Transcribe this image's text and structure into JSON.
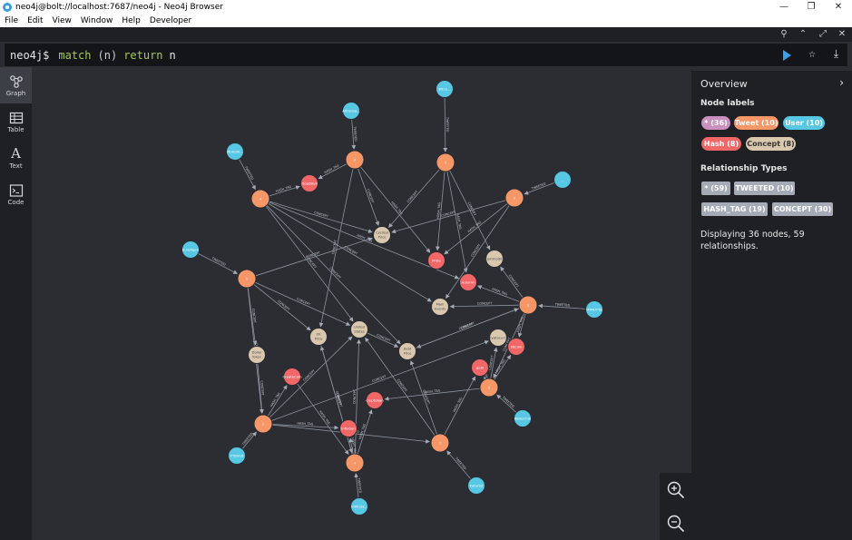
{
  "window": {
    "title": "neo4j@bolt://localhost:7687/neo4j - Neo4j Browser",
    "controls": [
      "—",
      "❐",
      "✕"
    ]
  },
  "menu": [
    "File",
    "Edit",
    "View",
    "Window",
    "Help",
    "Developer"
  ],
  "editor": {
    "prompt": "neo4j$",
    "kw1": "match",
    "var": "n",
    "kw2": "return",
    "ret": "n"
  },
  "sidebar": [
    {
      "label": "Graph",
      "icon": "graph-icon"
    },
    {
      "label": "Table",
      "icon": "table-icon"
    },
    {
      "label": "Text",
      "icon": "text-icon"
    },
    {
      "label": "Code",
      "icon": "code-icon"
    }
  ],
  "overview": {
    "title": "Overview",
    "node_labels_title": "Node labels",
    "node_labels": [
      {
        "text": "* (36)",
        "color": "#c990c0"
      },
      {
        "text": "Tweet (10)",
        "color": "#f79767"
      },
      {
        "text": "User (10)",
        "color": "#57c7e3"
      },
      {
        "text": "Hash (8)",
        "color": "#f16667"
      },
      {
        "text": "Concept (8)",
        "color": "#d9c8ae"
      }
    ],
    "rel_types_title": "Relationship Types",
    "rel_types": [
      "* (59)",
      "TWEETED (10)",
      "HASH_TAG (19)",
      "CONCEPT (30)"
    ],
    "status": "Displaying 36 nodes, 59 relationships."
  },
  "colors": {
    "tweet": "#f79767",
    "user": "#57c7e3",
    "hash": "#f16667",
    "concept": "#d9c8ae",
    "run": "#3aa0e8"
  },
  "graph": {
    "nodes": [
      {
        "id": "t1",
        "type": "tweet",
        "label": "4"
      },
      {
        "id": "t2",
        "type": "tweet",
        "label": "1"
      },
      {
        "id": "t3",
        "type": "tweet",
        "label": "4"
      },
      {
        "id": "t4",
        "type": "tweet",
        "label": "9"
      },
      {
        "id": "t5",
        "type": "tweet",
        "label": "1"
      },
      {
        "id": "t6",
        "type": "tweet",
        "label": "1"
      },
      {
        "id": "t7",
        "type": "tweet",
        "label": "1"
      },
      {
        "id": "t8",
        "type": "tweet",
        "label": "4"
      },
      {
        "id": "t9",
        "type": "tweet",
        "label": "1"
      },
      {
        "id": "t10",
        "type": "tweet",
        "label": "2"
      },
      {
        "id": "u1",
        "type": "user",
        "label": "Bitco..."
      },
      {
        "id": "u2",
        "type": "user",
        "label": "Altruista..."
      },
      {
        "id": "u3",
        "type": "user",
        "label": "Mufe90..."
      },
      {
        "id": "u4",
        "type": "user",
        "label": "..."
      },
      {
        "id": "u5",
        "type": "user",
        "label": "EuroAgen"
      },
      {
        "id": "u6",
        "type": "user",
        "label": "IMMUTTA"
      },
      {
        "id": "u7",
        "type": "user",
        "label": "Kellerchai"
      },
      {
        "id": "u8",
        "type": "user",
        "label": "FTBimit"
      },
      {
        "id": "u9",
        "type": "user",
        "label": "FuturSo"
      },
      {
        "id": "u10",
        "type": "user",
        "label": "Infiltrat..."
      },
      {
        "id": "h1",
        "type": "hash",
        "label": "GoodBull"
      },
      {
        "id": "h2",
        "type": "hash",
        "label": "Pride"
      },
      {
        "id": "h3",
        "type": "hash",
        "label": "Autumn"
      },
      {
        "id": "h4",
        "type": "hash",
        "label": "bitcoin"
      },
      {
        "id": "h5",
        "type": "hash",
        "label": "gold"
      },
      {
        "id": "h6",
        "type": "hash",
        "label": "CryptoCoin"
      },
      {
        "id": "h7",
        "type": "hash",
        "label": "cryptoban"
      },
      {
        "id": "h8",
        "type": "hash",
        "label": "Inflation"
      },
      {
        "id": "c1",
        "type": "concept",
        "label": "Cyclical Price"
      },
      {
        "id": "c2",
        "type": "concept",
        "label": "Commodity"
      },
      {
        "id": "c3",
        "type": "concept",
        "label": "Main Events"
      },
      {
        "id": "c4",
        "type": "concept",
        "label": "United States"
      },
      {
        "id": "c5",
        "type": "concept",
        "label": "Oil Price"
      },
      {
        "id": "c6",
        "type": "concept",
        "label": "Dollar Token"
      },
      {
        "id": "c7",
        "type": "concept",
        "label": "Debt Price"
      },
      {
        "id": "c8",
        "type": "concept",
        "label": "Cryptocurr..."
      }
    ],
    "edges": [
      {
        "s": "u1",
        "t": "t2",
        "label": "TWEETED"
      },
      {
        "s": "u2",
        "t": "t1",
        "label": "TWEETED"
      },
      {
        "s": "u3",
        "t": "t3",
        "label": "TWEETED"
      },
      {
        "s": "u4",
        "t": "t4",
        "label": "TWEETED"
      },
      {
        "s": "u5",
        "t": "t5",
        "label": "TWEETED"
      },
      {
        "s": "u6",
        "t": "t6",
        "label": "TWEETED"
      },
      {
        "s": "u7",
        "t": "t10",
        "label": "TWEETED"
      },
      {
        "s": "u8",
        "t": "t7",
        "label": "TWEETED"
      },
      {
        "s": "u9",
        "t": "t9",
        "label": "TWEETED"
      },
      {
        "s": "u10",
        "t": "t8",
        "label": "TWEETED"
      },
      {
        "s": "t1",
        "t": "h1",
        "label": "HASH_TAG"
      },
      {
        "s": "t1",
        "t": "c1",
        "label": "CONCEPT"
      },
      {
        "s": "t1",
        "t": "h2",
        "label": "HASH_TAG"
      },
      {
        "s": "t1",
        "t": "c5",
        "label": "CONCEPT"
      },
      {
        "s": "t3",
        "t": "h1",
        "label": "HASH_TAG"
      },
      {
        "s": "t3",
        "t": "c1",
        "label": "CONCEPT"
      },
      {
        "s": "t3",
        "t": "c4",
        "label": "CONCEPT"
      },
      {
        "s": "t3",
        "t": "c7",
        "label": "CONCEPT"
      },
      {
        "s": "t3",
        "t": "c3",
        "label": "CONCEPT"
      },
      {
        "s": "t3",
        "t": "h3",
        "label": "HASH_TAG"
      },
      {
        "s": "t2",
        "t": "c1",
        "label": "CONCEPT"
      },
      {
        "s": "t2",
        "t": "c2",
        "label": "CONCEPT"
      },
      {
        "s": "t2",
        "t": "h3",
        "label": "HASH_TAG"
      },
      {
        "s": "t2",
        "t": "h2",
        "label": "HASH_TAG"
      },
      {
        "s": "t4",
        "t": "c1",
        "label": "CONCEPT"
      },
      {
        "s": "t4",
        "t": "h2",
        "label": "HASH_TAG"
      },
      {
        "s": "t4",
        "t": "c3",
        "label": "CONCEPT"
      },
      {
        "s": "t5",
        "t": "c1",
        "label": "CONCEPT"
      },
      {
        "s": "t5",
        "t": "c4",
        "label": "CONCEPT"
      },
      {
        "s": "t5",
        "t": "c6",
        "label": "CONCEPT"
      },
      {
        "s": "t5",
        "t": "c5",
        "label": "CONCEPT"
      },
      {
        "s": "t5",
        "t": "t7",
        "label": "CONCEPT"
      },
      {
        "s": "t6",
        "t": "h3",
        "label": "HASH_TAG"
      },
      {
        "s": "t6",
        "t": "c2",
        "label": "CONCEPT"
      },
      {
        "s": "t6",
        "t": "c3",
        "label": "CONCEPT"
      },
      {
        "s": "t6",
        "t": "c7",
        "label": "CONCEPT"
      },
      {
        "s": "t6",
        "t": "h4",
        "label": "HASH_TAG"
      },
      {
        "s": "t6",
        "t": "t10",
        "label": "CONCEPT"
      },
      {
        "s": "t7",
        "t": "c4",
        "label": "CONCEPT"
      },
      {
        "s": "t7",
        "t": "h6",
        "label": "HASH_TAG"
      },
      {
        "s": "t7",
        "t": "c8",
        "label": "CONCEPT"
      },
      {
        "s": "t7",
        "t": "h8",
        "label": "HASH_TAG"
      },
      {
        "s": "t7",
        "t": "t9",
        "label": "HASH_TAG"
      },
      {
        "s": "t8",
        "t": "c4",
        "label": "CONCEPT"
      },
      {
        "s": "t8",
        "t": "h7",
        "label": "HASH_TAG"
      },
      {
        "s": "t8",
        "t": "c5",
        "label": "CONCEPT"
      },
      {
        "s": "t8",
        "t": "h8",
        "label": "HASH_TAG"
      },
      {
        "s": "t9",
        "t": "c4",
        "label": "CONCEPT"
      },
      {
        "s": "t9",
        "t": "h5",
        "label": "HASH_TAG"
      },
      {
        "s": "t9",
        "t": "c7",
        "label": "CONCEPT"
      },
      {
        "s": "t10",
        "t": "h4",
        "label": "HASH_TAG"
      },
      {
        "s": "t10",
        "t": "h5",
        "label": "HASH_TAG"
      },
      {
        "s": "t10",
        "t": "c8",
        "label": "CONCEPT"
      },
      {
        "s": "t10",
        "t": "h7",
        "label": "HASH_TAG"
      },
      {
        "s": "c4",
        "t": "c7",
        "label": "CONCEPT"
      },
      {
        "s": "c6",
        "t": "t7",
        "label": "CONCEPT"
      },
      {
        "s": "h6",
        "t": "t8",
        "label": "HASH_TAG"
      },
      {
        "s": "c5",
        "t": "t8",
        "label": "CONCEPT"
      },
      {
        "s": "c7",
        "t": "t6",
        "label": "CONCEPT"
      }
    ]
  }
}
